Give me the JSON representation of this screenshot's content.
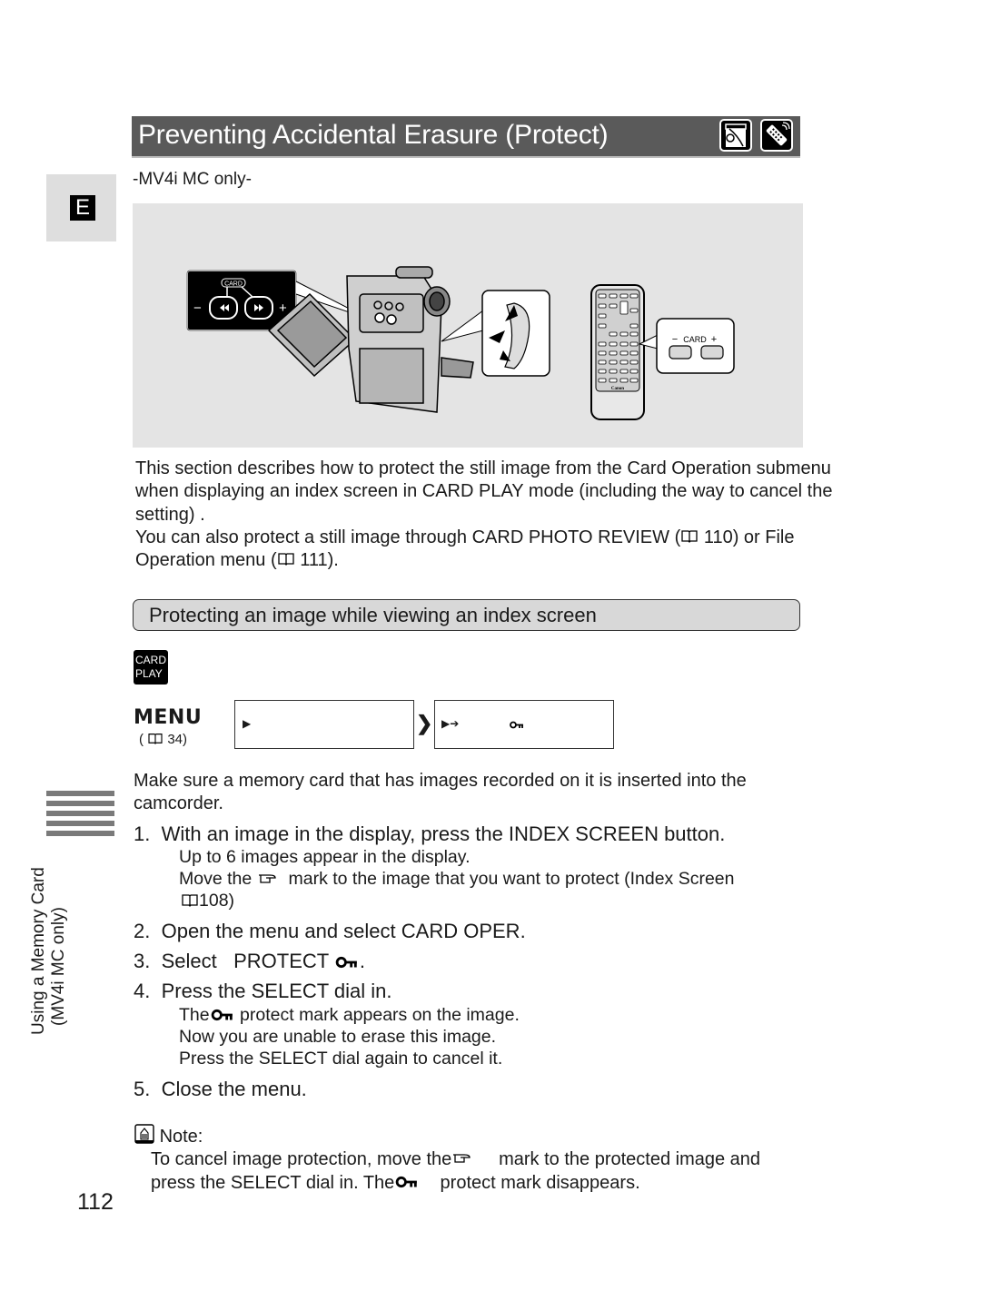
{
  "header": {
    "title": "Preventing Accidental Erasure (Protect)",
    "icons": [
      "camcorder-lcd-icon",
      "wireless-remote-icon"
    ]
  },
  "language_tab": "E",
  "model_note": "-MV4i MC only-",
  "figure": {
    "camera_callout": {
      "label": "CARD",
      "minus": "−",
      "plus": "+",
      "buttons": [
        "◀◀",
        "▶▶"
      ]
    },
    "remote_callout": {
      "label": "CARD",
      "minus": "−",
      "plus": "+"
    },
    "remote_brand": "Canon"
  },
  "intro": {
    "line1": "This section describes how to protect the still image from the Card Operation submenu when displaying an index screen in CARD PLAY mode (including the way to cancel the setting) .",
    "line2_a": "You can also protect a still image through CARD PHOTO REVIEW (",
    "line2_b": "110) or File Operation menu (",
    "line2_c": "111)."
  },
  "section": {
    "title": "Protecting an image while viewing an index screen",
    "mode_badge": [
      "CARD",
      "PLAY"
    ]
  },
  "menu": {
    "label": "MENU",
    "ref_open": "(",
    "ref_page": "34)",
    "box1_marker": "▶",
    "box2_marker": "▶➔",
    "chevron": "❯"
  },
  "prereq": "Make sure a memory card that has images recorded on it is inserted into the camcorder.",
  "steps": [
    {
      "num": "1.",
      "text": "With an image in the display, press the INDEX SCREEN button.",
      "subs": [
        "Up to 6 images appear in the display.",
        "Move the",
        "mark to the image that you want to protect (Index Screen",
        "108)"
      ]
    },
    {
      "num": "2.",
      "text": "Open the menu and select CARD OPER."
    },
    {
      "num": "3.",
      "text": "Select   PROTECT",
      "suffix": "."
    },
    {
      "num": "4.",
      "text": "Press the SELECT dial in.",
      "subs": [
        "The",
        "protect mark appears on the image.",
        "Now you are unable to erase this image.",
        "Press the SELECT dial again to cancel it."
      ]
    },
    {
      "num": "5.",
      "text": "Close the menu."
    }
  ],
  "note": {
    "label": "Note:",
    "line1_a": "To cancel image protection, move the",
    "line1_b": "mark to the protected image and",
    "line2_a": "press the SELECT dial in. The",
    "line2_b": "protect mark disappears."
  },
  "side_label": {
    "line1": "Using a Memory Card",
    "line2": "(MV4i MC only)"
  },
  "page_number": "112"
}
